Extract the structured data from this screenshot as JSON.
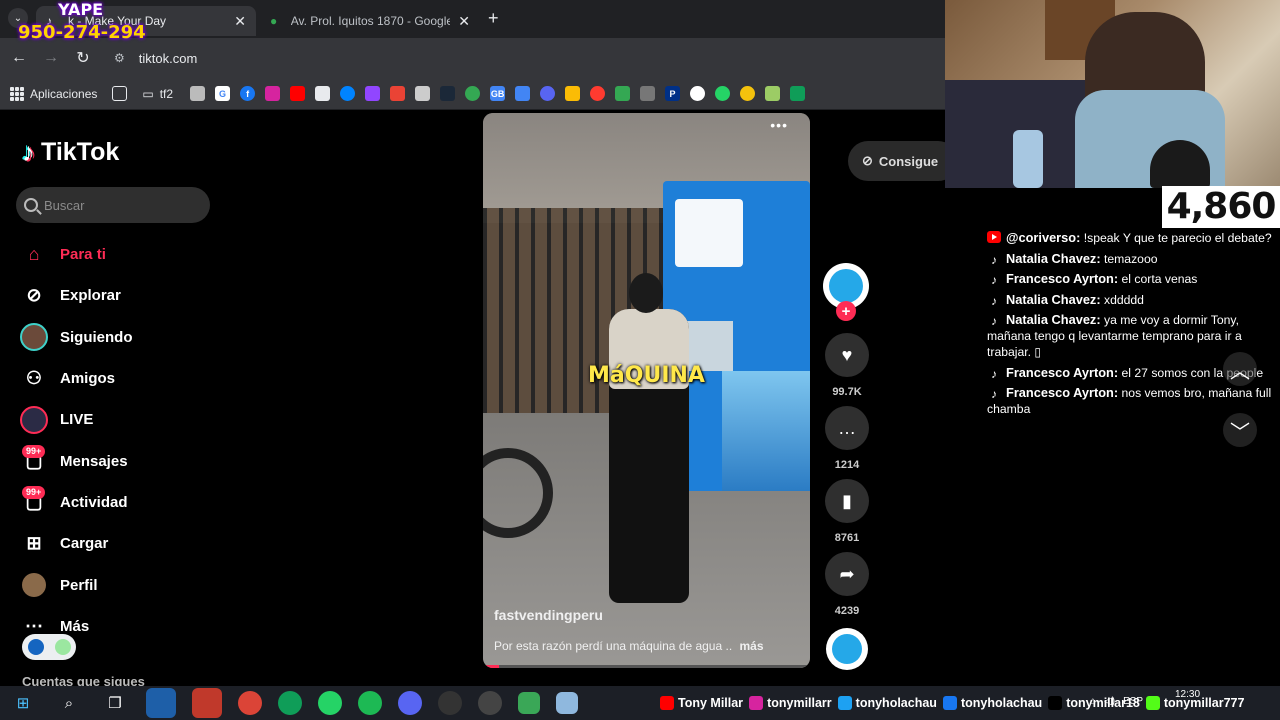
{
  "overlay_top_left": {
    "line1": "YAPE",
    "line2": "950-274-294"
  },
  "browser": {
    "tabs": [
      {
        "title": "k - Make Your Day",
        "close": "✕"
      },
      {
        "title": "Av. Prol. Iquitos 1870 - Google M",
        "close": "✕"
      }
    ],
    "new_tab": "+",
    "url": "tiktok.com",
    "bookmarks": {
      "apps_label": "Aplicaciones",
      "folder_label": "tf2"
    }
  },
  "tiktok": {
    "logo_text": "TikTok",
    "search_placeholder": "Buscar",
    "nav": [
      {
        "label": "Para ti",
        "icon": "home-icon"
      },
      {
        "label": "Explorar",
        "icon": "compass-icon"
      },
      {
        "label": "Siguiendo",
        "icon": "following-avatar-icon"
      },
      {
        "label": "Amigos",
        "icon": "friends-icon"
      },
      {
        "label": "LIVE",
        "icon": "live-icon"
      },
      {
        "label": "Mensajes",
        "icon": "messages-icon",
        "badge": "99+"
      },
      {
        "label": "Actividad",
        "icon": "activity-icon",
        "badge": "99+"
      },
      {
        "label": "Cargar",
        "icon": "upload-icon"
      },
      {
        "label": "Perfil",
        "icon": "profile-avatar-icon"
      },
      {
        "label": "Más",
        "icon": "more-icon"
      }
    ],
    "cuentas_label": "Cuentas que sigues",
    "get_app_label": "Consigue",
    "video": {
      "caption_overlay": "MáQUINA",
      "author": "fastvendingperu",
      "description": "Por esta razón perdí una máquina de agua ..",
      "more": "más",
      "progress": 0.05
    },
    "actions": {
      "likes": "99.7K",
      "comments": "1214",
      "saves": "8761",
      "shares": "4239"
    }
  },
  "stream": {
    "counter": "4,860",
    "chat": [
      {
        "source": "youtube",
        "user": "@coriverso:",
        "text": " !speak Y que te parecio el debate?"
      },
      {
        "source": "tiktok",
        "user": "Natalia Chavez:",
        "text": " temazooo"
      },
      {
        "source": "tiktok",
        "user": "Francesco Ayrton:",
        "text": " el corta venas"
      },
      {
        "source": "tiktok",
        "user": "Natalia Chavez:",
        "text": " xddddd"
      },
      {
        "source": "tiktok",
        "user": "Natalia Chavez:",
        "text": " ya me voy a dormir Tony, mañana tengo q levantarme temprano para ir a trabajar. ▯"
      },
      {
        "source": "tiktok",
        "user": "Francesco Ayrton:",
        "text": " el 27 somos con la people"
      },
      {
        "source": "tiktok",
        "user": "Francesco Ayrton:",
        "text": " nos vemos bro, mañana full chamba"
      }
    ]
  },
  "taskbar": {
    "socials": [
      {
        "platform": "youtube",
        "handle": "Tony Millar"
      },
      {
        "platform": "instagram",
        "handle": "tonymillarr"
      },
      {
        "platform": "twitter",
        "handle": "tonyholachau"
      },
      {
        "platform": "facebook",
        "handle": "tonyholachau"
      },
      {
        "platform": "tiktok",
        "handle": "tonymillar18"
      },
      {
        "platform": "kick",
        "handle": "tonymillar777"
      }
    ],
    "time": "12:30",
    "lang": "ESP"
  },
  "colors": {
    "tiktok_red": "#fe2c55",
    "tiktok_cyan": "#25f4ee",
    "chrome_dark": "#202124",
    "chrome_mid": "#35363a",
    "yape_purple": "#6a00c8"
  }
}
